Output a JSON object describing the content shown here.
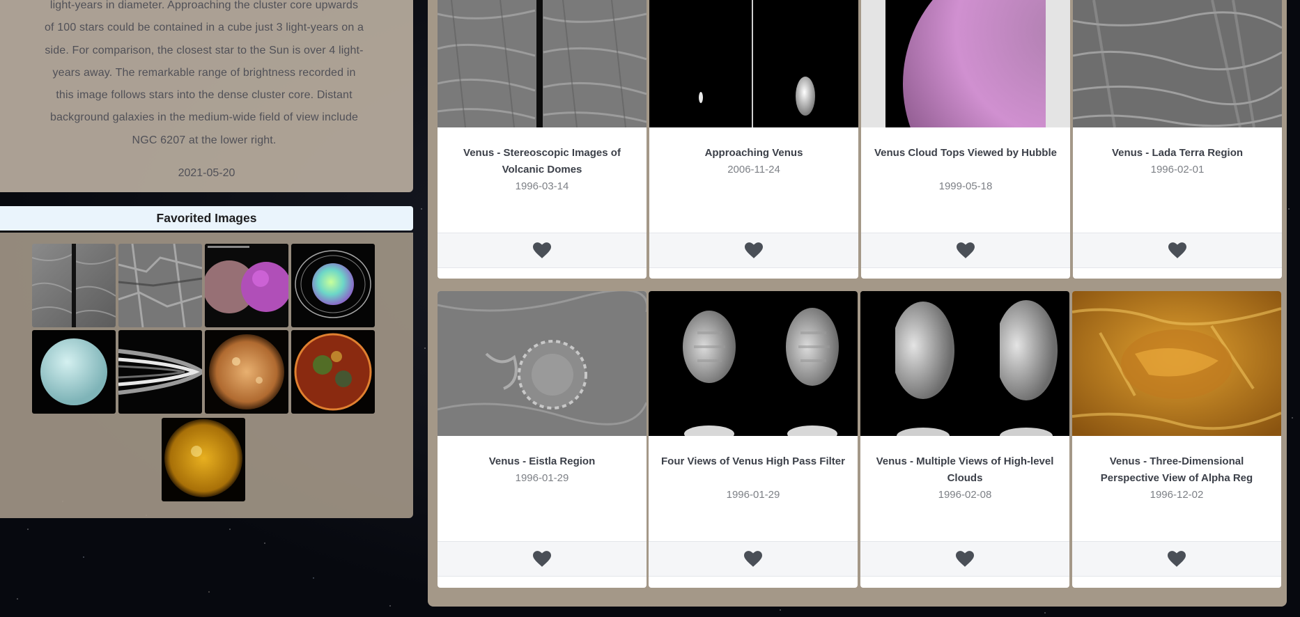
{
  "description": {
    "lines": [
      "light-years in diameter. Approaching the cluster core upwards",
      "of 100 stars could be contained in a cube just 3 light-years on a",
      "side. For comparison, the closest star to the Sun is over 4 light-",
      "years away. The remarkable range of brightness recorded in",
      "this image follows stars into the dense cluster core. Distant",
      "background galaxies in the medium-wide field of view include",
      "NGC 6207 at the lower right."
    ],
    "date": "2021-05-20"
  },
  "favorites": {
    "title": "Favorited Images",
    "thumbs": [
      {
        "name": "fav-venus-stereo-radar"
      },
      {
        "name": "fav-venus-radar-terrain"
      },
      {
        "name": "fav-mars-maven-ultraviolet"
      },
      {
        "name": "fav-uranus-infrared-rings"
      },
      {
        "name": "fav-uranus-cyan"
      },
      {
        "name": "fav-saturn-rings"
      },
      {
        "name": "fav-sun-orange"
      },
      {
        "name": "fav-sun-multicolor"
      },
      {
        "name": "fav-sun-gold"
      }
    ]
  },
  "cards": [
    {
      "title": "Venus - Stereoscopic Images of Volcanic Domes",
      "date": "1996-03-14"
    },
    {
      "title": "Approaching Venus",
      "date": "2006-11-24"
    },
    {
      "title": "Venus Cloud Tops Viewed by Hubble",
      "date": "1999-05-18"
    },
    {
      "title": "Venus - Lada Terra Region",
      "date": "1996-02-01"
    },
    {
      "title": "Venus - Eistla Region",
      "date": "1996-01-29"
    },
    {
      "title": "Four Views of Venus High Pass Filter",
      "date": "1996-01-29"
    },
    {
      "title": "Venus - Multiple Views of High-level Clouds",
      "date": "1996-02-08"
    },
    {
      "title": "Venus - Three-Dimensional Perspective View of Alpha Reg",
      "date": "1996-12-02"
    }
  ],
  "colors": {
    "heart": "#4a4f57",
    "panel": "#a49888",
    "header_bg": "#eaf4fc"
  },
  "icons": {
    "favorite": "heart-icon"
  }
}
